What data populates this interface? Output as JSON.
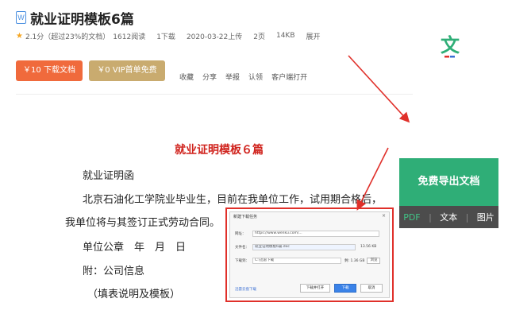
{
  "header": {
    "doc_type_icon": "W",
    "title": "就业证明模板6篇",
    "rating": "2.1分（超过23%的文档）",
    "reads": "1612阅读",
    "downloads": "1下载",
    "upload_date": "2020-03-22上传",
    "pages": "2页",
    "size": "14KB",
    "expand": "展开"
  },
  "buttons": {
    "download": "￥10 下载文档",
    "vip": "￥0 VIP首单免费"
  },
  "actions": [
    "收藏",
    "分享",
    "举报",
    "认领",
    "客户端打开"
  ],
  "brand_icon": {
    "glyph": "文",
    "color": "#2fae77",
    "underline_color": "#e0302a"
  },
  "document": {
    "heading": "就业证明模板６篇",
    "lines": [
      "就业证明函",
      "北京石油化工学院业毕业生，目前在我单位工作，试用期合格后，",
      "我单位将与其签订正式劳动合同。",
      "单位公章　年　月　日",
      "附：公司信息",
      "（填表说明及模板）"
    ]
  },
  "side_panel": {
    "export": "免费导出文档",
    "formats": [
      "PDF",
      "文本",
      "图片"
    ]
  },
  "dialog": {
    "title": "新建下载任务",
    "close": "×",
    "url_label": "网址：",
    "url_value": "https://www.wenku.com/...",
    "name_label": "文件名：",
    "name_value": "就业证明模板6篇.doc",
    "name_size": "13.56 KB",
    "path_label": "下载到：",
    "path_value": "C:\\迅雷下载",
    "path_free": "剩: 1.36 GB",
    "browse": "浏览",
    "link": "迅雷云盘下载",
    "open_after": "下载并打开",
    "download": "下载",
    "cancel": "取消"
  },
  "colors": {
    "arrow": "#e0302a",
    "download_btn": "#f06a3c",
    "vip_btn": "#c9ab6f",
    "export_green": "#2fae77",
    "heading_red": "#d0231d"
  }
}
